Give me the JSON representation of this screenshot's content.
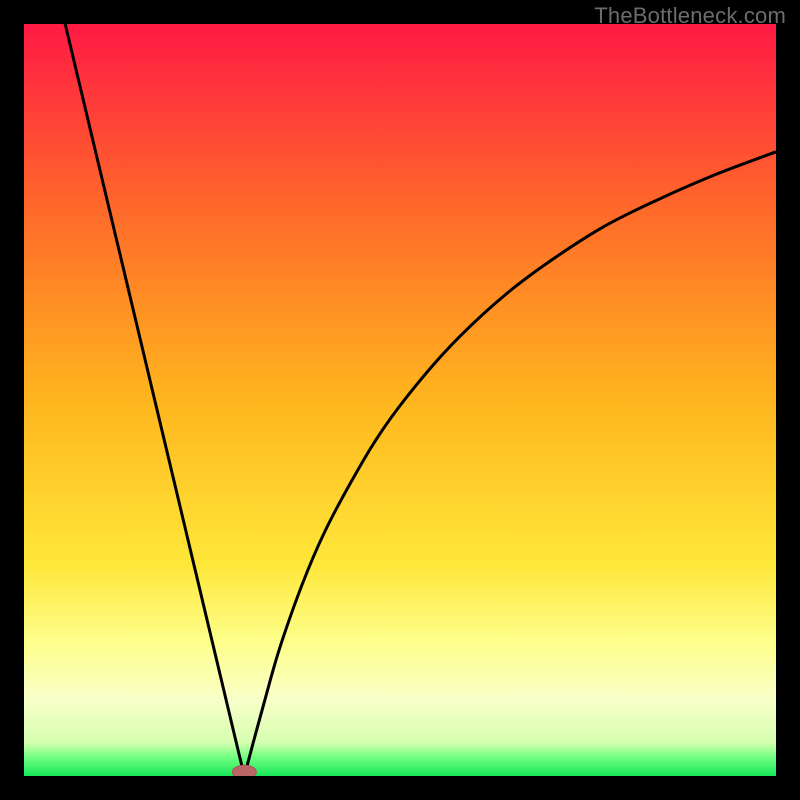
{
  "watermark": "TheBottleneck.com",
  "colors": {
    "black": "#000000",
    "curve": "#000000",
    "marker_fill": "#bb6666",
    "marker_stroke": "#aa5555"
  },
  "chart_data": {
    "type": "line",
    "title": "",
    "xlabel": "",
    "ylabel": "",
    "xlim": [
      0,
      100
    ],
    "ylim": [
      0,
      100
    ],
    "grid": false,
    "legend": false,
    "gradient_stops": [
      {
        "offset": 0.0,
        "color": "#ff1a44"
      },
      {
        "offset": 0.25,
        "color": "#ff6a2a"
      },
      {
        "offset": 0.5,
        "color": "#ffb61e"
      },
      {
        "offset": 0.72,
        "color": "#ffe73a"
      },
      {
        "offset": 0.82,
        "color": "#fdff8a"
      },
      {
        "offset": 0.9,
        "color": "#f8ffc8"
      },
      {
        "offset": 0.955,
        "color": "#d6ffb0"
      },
      {
        "offset": 0.975,
        "color": "#72ff80"
      },
      {
        "offset": 1.0,
        "color": "#17e85a"
      }
    ],
    "series": [
      {
        "name": "left-branch",
        "x": [
          5.0,
          7.0,
          9.0,
          11.0,
          13.0,
          15.0,
          17.0,
          19.0,
          21.0,
          23.0,
          25.0,
          27.0,
          28.5,
          29.3
        ],
        "y": [
          102.0,
          93.6,
          85.2,
          76.8,
          68.4,
          60.0,
          51.6,
          43.2,
          34.8,
          26.4,
          18.0,
          9.6,
          3.3,
          0.0
        ]
      },
      {
        "name": "right-branch",
        "x": [
          29.3,
          30.5,
          32.0,
          34.0,
          37.0,
          40.0,
          44.0,
          48.0,
          53.0,
          58.0,
          64.0,
          70.0,
          77.0,
          84.0,
          92.0,
          100.0
        ],
        "y": [
          0.0,
          4.5,
          10.0,
          17.0,
          25.5,
          32.5,
          40.0,
          46.5,
          53.0,
          58.5,
          64.0,
          68.5,
          73.0,
          76.5,
          80.0,
          83.0
        ]
      }
    ],
    "marker": {
      "x": 29.3,
      "y": 0.0,
      "rx": 1.6,
      "ry": 0.9
    }
  }
}
